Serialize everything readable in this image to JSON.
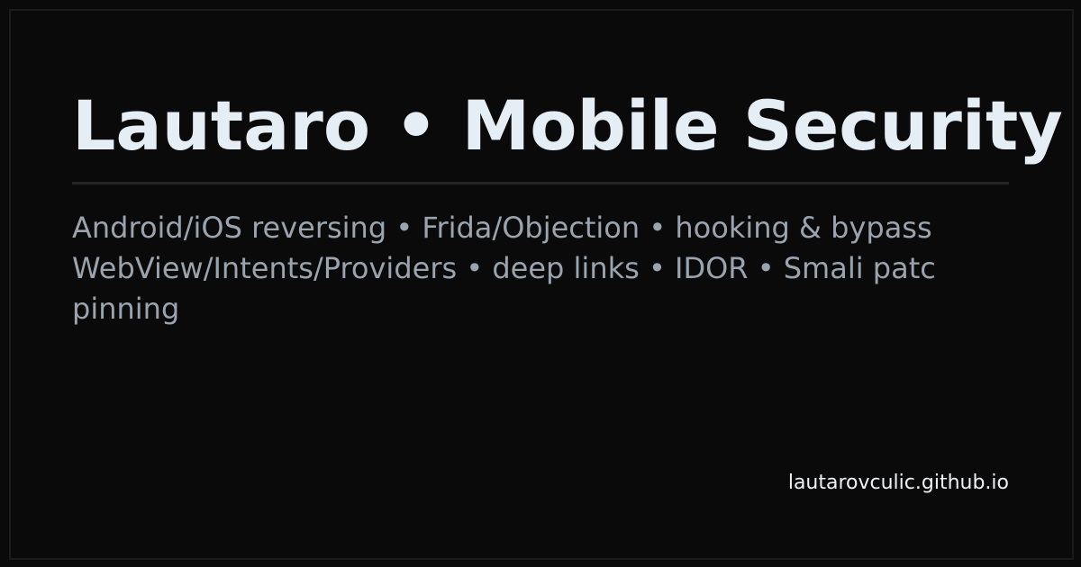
{
  "card": {
    "title": "Lautaro • Mobile Security",
    "subtitle_lines": [
      "Android/iOS reversing • Frida/Objection • hooking & bypass",
      "WebView/Intents/Providers • deep links • IDOR • Smali patc",
      "pinning"
    ],
    "site": "lautarovculic.github.io"
  },
  "colors": {
    "background": "#0a0a0a",
    "title": "#e6eef5",
    "subtitle": "#9aa4af",
    "divider": "#262626",
    "site": "#eef2f6"
  }
}
